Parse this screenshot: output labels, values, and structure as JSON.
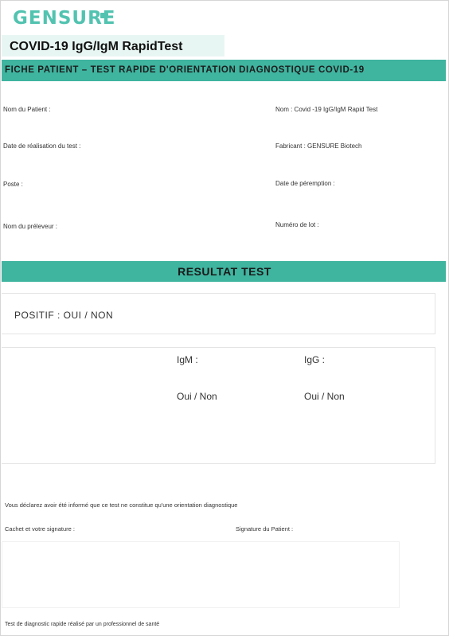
{
  "brand": {
    "logo_text": "GENSURE",
    "product_title": "COVID-19 IgG/IgM RapidTest"
  },
  "header": {
    "title": "FICHE PATIENT – TEST RAPIDE D'ORIENTATION DIAGNOSTIQUE COVID-19"
  },
  "fields": {
    "left": [
      "Nom du Patient :",
      "Date de réalisation du test :",
      "Poste :",
      "Nom du préleveur :"
    ],
    "right": [
      "Nom : Covid -19 IgG/IgM Rapid Test",
      "Fabricant : GENSURE Biotech",
      "Date de péremption :",
      "Numéro de lot :"
    ]
  },
  "result": {
    "title": "RESULTAT TEST",
    "positif": "POSITIF : OUI / NON",
    "igm_label": "IgM :",
    "igg_label": "IgG :",
    "igm_value": "Oui / Non",
    "igg_value": "Oui / Non"
  },
  "note": "Vous déclarez avoir été informé que ce test ne constitue qu'une orientation diagnostique",
  "signature": {
    "left_label": "Cachet et votre signature :",
    "right_label": "Signature du Patient :"
  },
  "footer": "Test de diagnostic rapide réalisé par un professionnel de santé"
}
